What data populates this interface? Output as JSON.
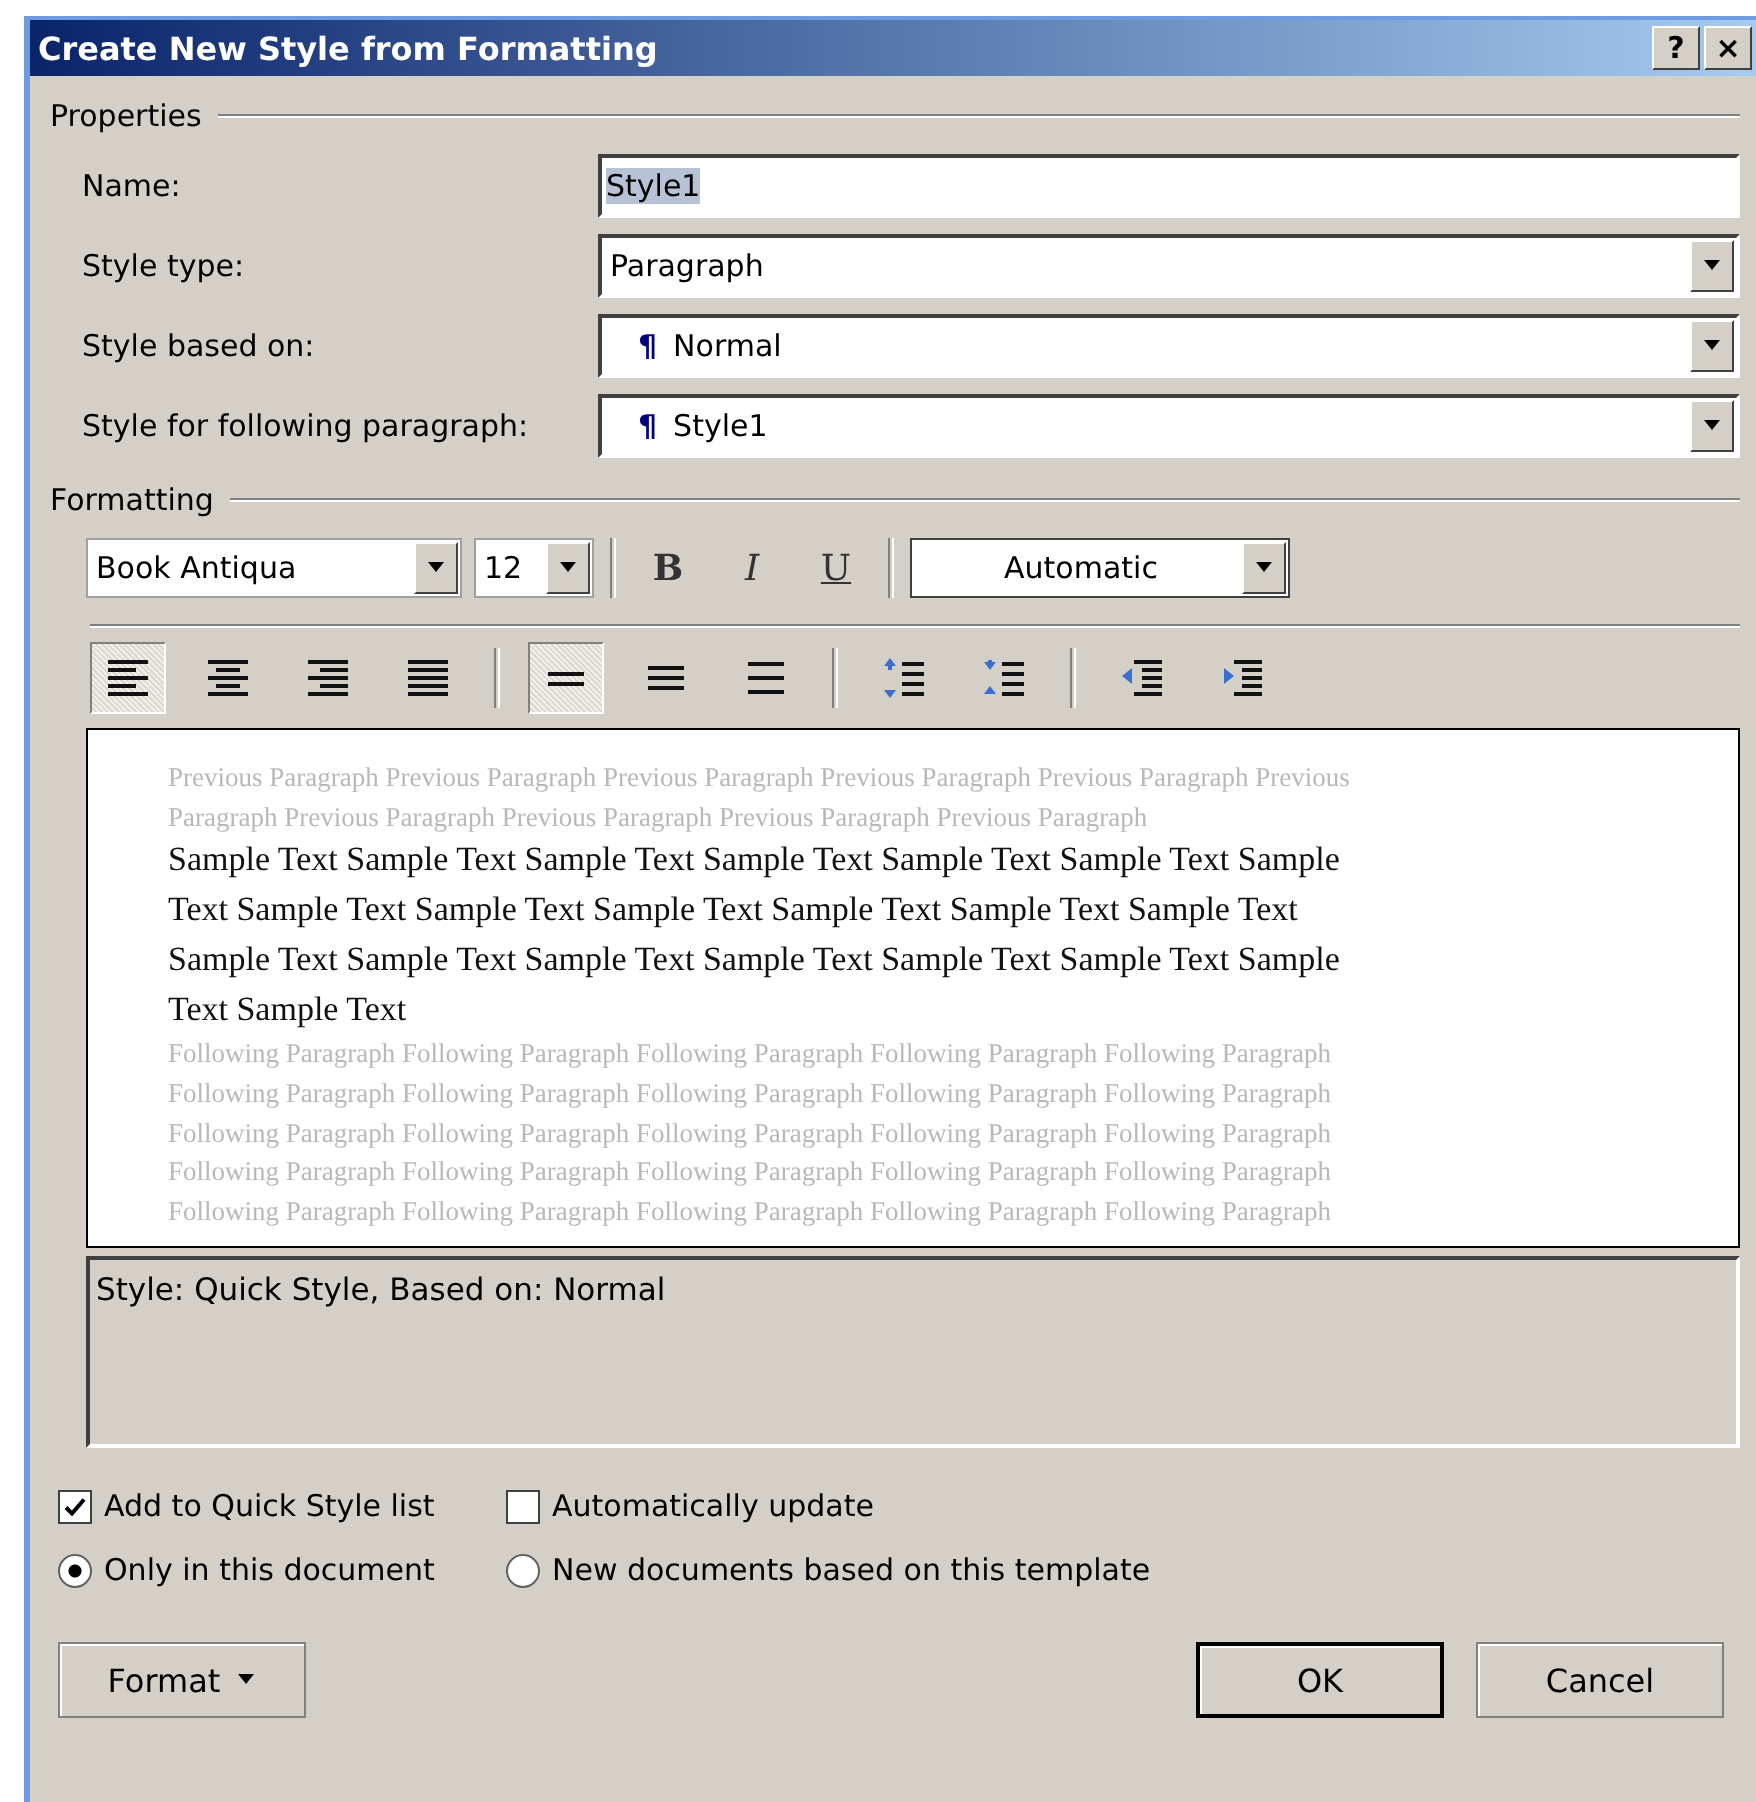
{
  "window": {
    "title": "Create New Style from Formatting",
    "title_buttons": [
      "?",
      "×"
    ]
  },
  "properties": {
    "heading": "Properties",
    "rows": [
      {
        "label": "Name:",
        "kind": "text",
        "value": "Style1",
        "value_selected": true
      },
      {
        "label": "Style type:",
        "kind": "dropdown",
        "value": "Paragraph"
      },
      {
        "label": "Style based on:",
        "kind": "dropdown",
        "value": "Normal",
        "mark": "¶"
      },
      {
        "label": "Style for following paragraph:",
        "kind": "dropdown",
        "value": "Style1",
        "mark": "¶"
      }
    ]
  },
  "formatting": {
    "heading": "Formatting",
    "font": "Book Antiqua",
    "size": "12",
    "styles": [
      {
        "label": "B",
        "kind": "bold",
        "selected": false
      },
      {
        "label": "I",
        "kind": "italic",
        "selected": false
      },
      {
        "label": "U",
        "kind": "underline",
        "selected": false
      }
    ],
    "font_color": "Automatic",
    "tools": [
      {
        "kind": "align-left",
        "selected": true
      },
      {
        "kind": "align-center",
        "selected": false
      },
      {
        "kind": "align-right",
        "selected": false
      },
      {
        "kind": "justify",
        "selected": false
      },
      {
        "kind": "sep"
      },
      {
        "kind": "single-spacing",
        "selected": true
      },
      {
        "kind": "one-half-spacing",
        "selected": false
      },
      {
        "kind": "double-spacing",
        "selected": false
      },
      {
        "kind": "sep"
      },
      {
        "kind": "space-before",
        "selected": false
      },
      {
        "kind": "space-after",
        "selected": false
      },
      {
        "kind": "sep"
      },
      {
        "kind": "outdent",
        "selected": false
      },
      {
        "kind": "indent",
        "selected": false
      }
    ]
  },
  "preview": {
    "previous": [
      "Previous Paragraph Previous Paragraph Previous Paragraph Previous Paragraph Previous Paragraph Previous",
      "Paragraph Previous Paragraph Previous Paragraph Previous Paragraph Previous Paragraph"
    ],
    "sample": [
      "Sample Text Sample Text Sample Text Sample Text Sample Text Sample Text Sample",
      "Text Sample Text Sample Text Sample Text Sample Text Sample Text Sample Text",
      "Sample Text Sample Text Sample Text Sample Text Sample Text Sample Text Sample",
      "Text Sample Text"
    ],
    "following": [
      "Following Paragraph Following Paragraph Following Paragraph Following Paragraph Following Paragraph",
      "Following Paragraph Following Paragraph Following Paragraph Following Paragraph Following Paragraph",
      "Following Paragraph Following Paragraph Following Paragraph Following Paragraph Following Paragraph",
      "Following Paragraph Following Paragraph Following Paragraph Following Paragraph Following Paragraph",
      "Following Paragraph Following Paragraph Following Paragraph Following Paragraph Following Paragraph"
    ]
  },
  "description": "Style: Quick Style, Based on: Normal",
  "checkboxes": [
    {
      "label": "Add to Quick Style list",
      "checked": true
    },
    {
      "label": "Automatically update",
      "checked": false
    }
  ],
  "radios": [
    {
      "label": "Only in this document",
      "selected": true
    },
    {
      "label": "New documents based on this template",
      "selected": false
    }
  ],
  "buttons": {
    "format": "Format",
    "ok": "OK",
    "cancel": "Cancel"
  }
}
